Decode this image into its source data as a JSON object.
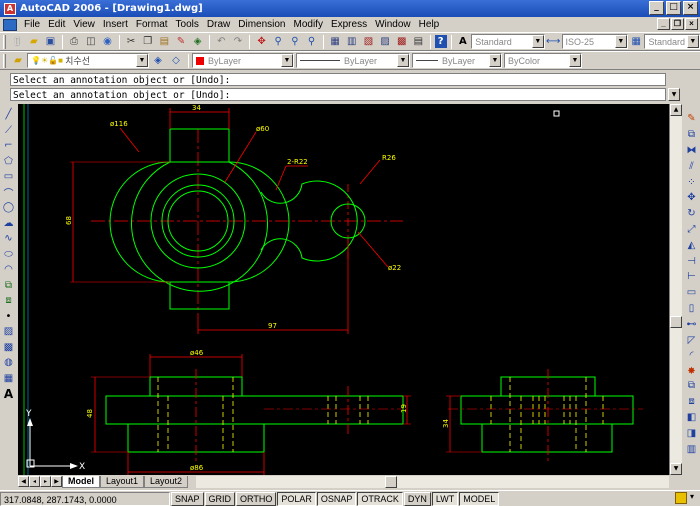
{
  "window": {
    "title": "AutoCAD 2006 - [Drawing1.dwg]"
  },
  "menu": [
    "File",
    "Edit",
    "View",
    "Insert",
    "Format",
    "Tools",
    "Draw",
    "Dimension",
    "Modify",
    "Express",
    "Window",
    "Help"
  ],
  "toolbar": {
    "text_style": "Standard",
    "dim_style": "ISO-25",
    "table_style": "Standard",
    "layer": "치수선",
    "color": "ByLayer",
    "linetype": "ByLayer",
    "lineweight": "ByLayer",
    "plotstyle": "ByColor"
  },
  "command": {
    "line1": "Select an annotation object or [Undo]:",
    "line2": "Select an annotation object or [Undo]:"
  },
  "drawing": {
    "dims": {
      "top_width": "34",
      "outer_dia": "ø116",
      "inner_dia": "ø60",
      "radius_22": "2-R22",
      "radius_26": "R26",
      "hole_dia": "ø22",
      "height": "68",
      "center_dist": "97",
      "front_46": "ø46",
      "front_height": "48",
      "front_86": "ø86",
      "front_19": "19",
      "side_34": "34"
    },
    "ucs_x": "X",
    "ucs_y": "Y"
  },
  "tabs": [
    "Model",
    "Layout1",
    "Layout2"
  ],
  "status": {
    "coords": "317.0848, 287.1743, 0.0000",
    "buttons": [
      "SNAP",
      "GRID",
      "ORTHO",
      "POLAR",
      "OSNAP",
      "OTRACK",
      "DYN",
      "LWT",
      "MODEL"
    ],
    "active": [
      "POLAR",
      "OSNAP",
      "OTRACK",
      "LWT",
      "MODEL"
    ]
  },
  "colors": {
    "canvas": "#000000",
    "geometry": "#00ff00",
    "dimension": "#ff0000",
    "dim_text": "#ffff00",
    "titlebar": "#1b4db6"
  }
}
